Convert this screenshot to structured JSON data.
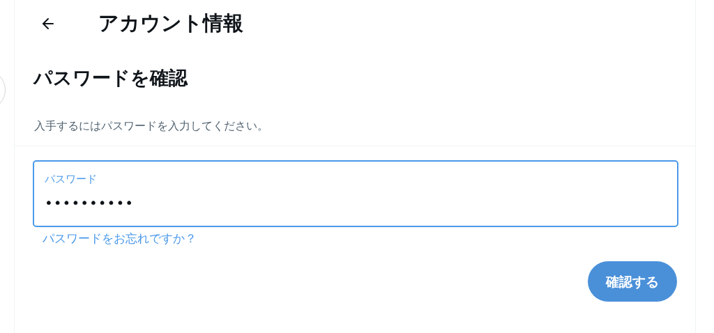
{
  "header": {
    "title": "アカウント情報"
  },
  "heading": "パスワードを確認",
  "description": "入手するにはパスワードを入力してください。",
  "password_field": {
    "label": "パスワード",
    "value": "••••••••••",
    "focused": true
  },
  "forgot_link": "パスワードをお忘れですか？",
  "confirm_button": "確認する"
}
